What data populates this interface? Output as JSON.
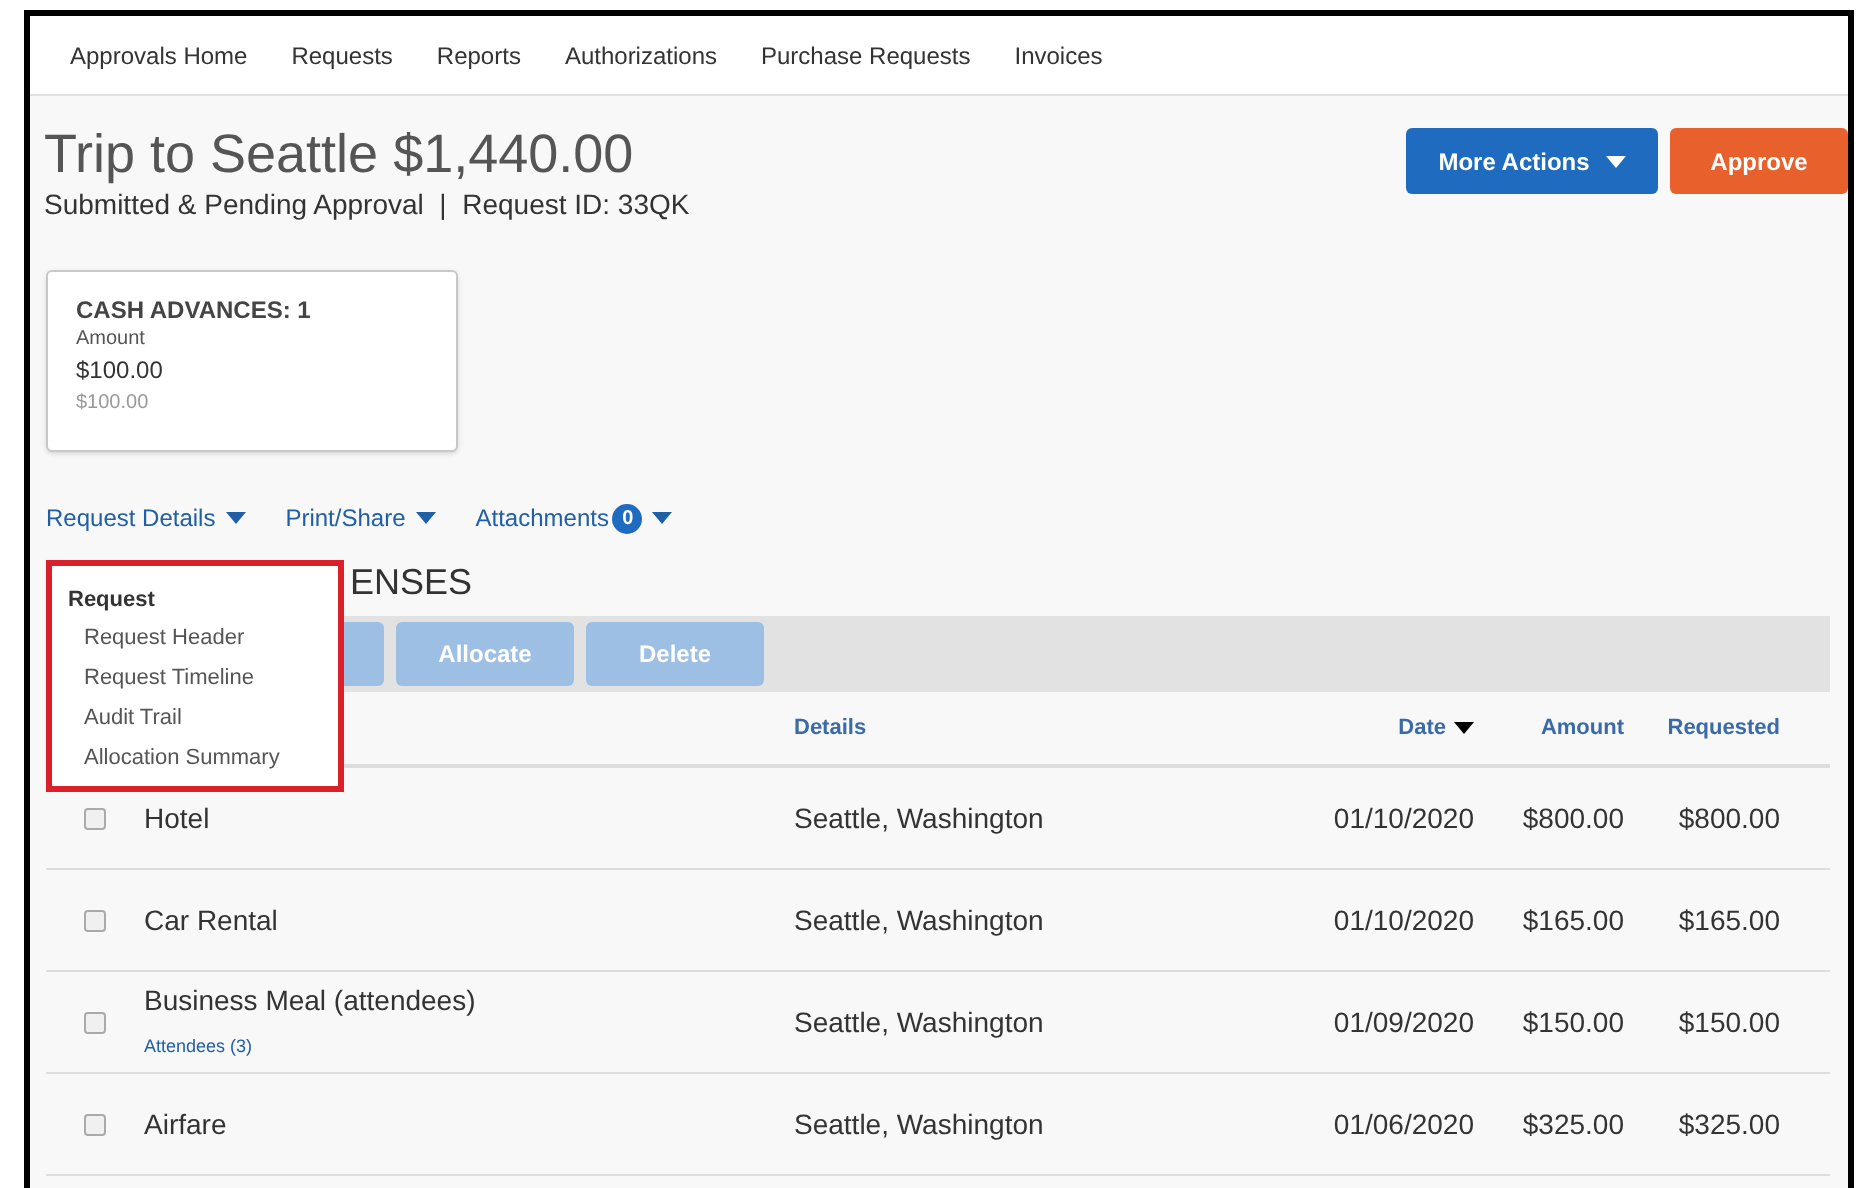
{
  "nav": [
    "Approvals Home",
    "Requests",
    "Reports",
    "Authorizations",
    "Purchase Requests",
    "Invoices"
  ],
  "title": "Trip to Seattle $1,440.00",
  "subtitle": "Submitted & Pending Approval  |  Request ID: 33QK",
  "buttons": [
    {
      "label": "More Actions",
      "kind": "menu"
    },
    {
      "label": "Approve",
      "kind": "primary"
    }
  ],
  "card": {
    "heading": "CASH ADVANCES: 1",
    "label": "Amount",
    "amount": "$100.00",
    "sub_amount": "$100.00"
  },
  "links": [
    {
      "label": "Request Details"
    },
    {
      "label": "Print/Share"
    },
    {
      "label": "Attachments",
      "badge": "0"
    }
  ],
  "menu": {
    "heading": "Request",
    "items": [
      "Request Header",
      "Request Timeline",
      "Audit Trail",
      "Allocation Summary"
    ]
  },
  "section_heading": "ENSES",
  "toolbar": [
    {
      "disabled": true
    },
    {
      "label": "Allocate",
      "disabled": true
    },
    {
      "label": "Delete",
      "disabled": true
    }
  ],
  "columns": [
    {
      "label": "Details",
      "sorted": false
    },
    {
      "label": "Date",
      "sorted": true
    },
    {
      "label": "Amount",
      "sorted": false
    },
    {
      "label": "Requested",
      "sorted": false
    }
  ],
  "rows": [
    {
      "checked": false,
      "name": "Hotel",
      "details": "Seattle, Washington",
      "date": "01/10/2020",
      "amount": "$800.00",
      "requested": "$800.00"
    },
    {
      "checked": false,
      "name": "Car Rental",
      "details": "Seattle, Washington",
      "date": "01/10/2020",
      "amount": "$165.00",
      "requested": "$165.00"
    },
    {
      "checked": false,
      "name": "Business Meal (attendees)",
      "sub_link": "Attendees (3)",
      "details": "Seattle, Washington",
      "date": "01/09/2020",
      "amount": "$150.00",
      "requested": "$150.00"
    },
    {
      "checked": false,
      "name": "Airfare",
      "details": "Seattle, Washington",
      "date": "01/06/2020",
      "amount": "$325.00",
      "requested": "$325.00"
    }
  ]
}
